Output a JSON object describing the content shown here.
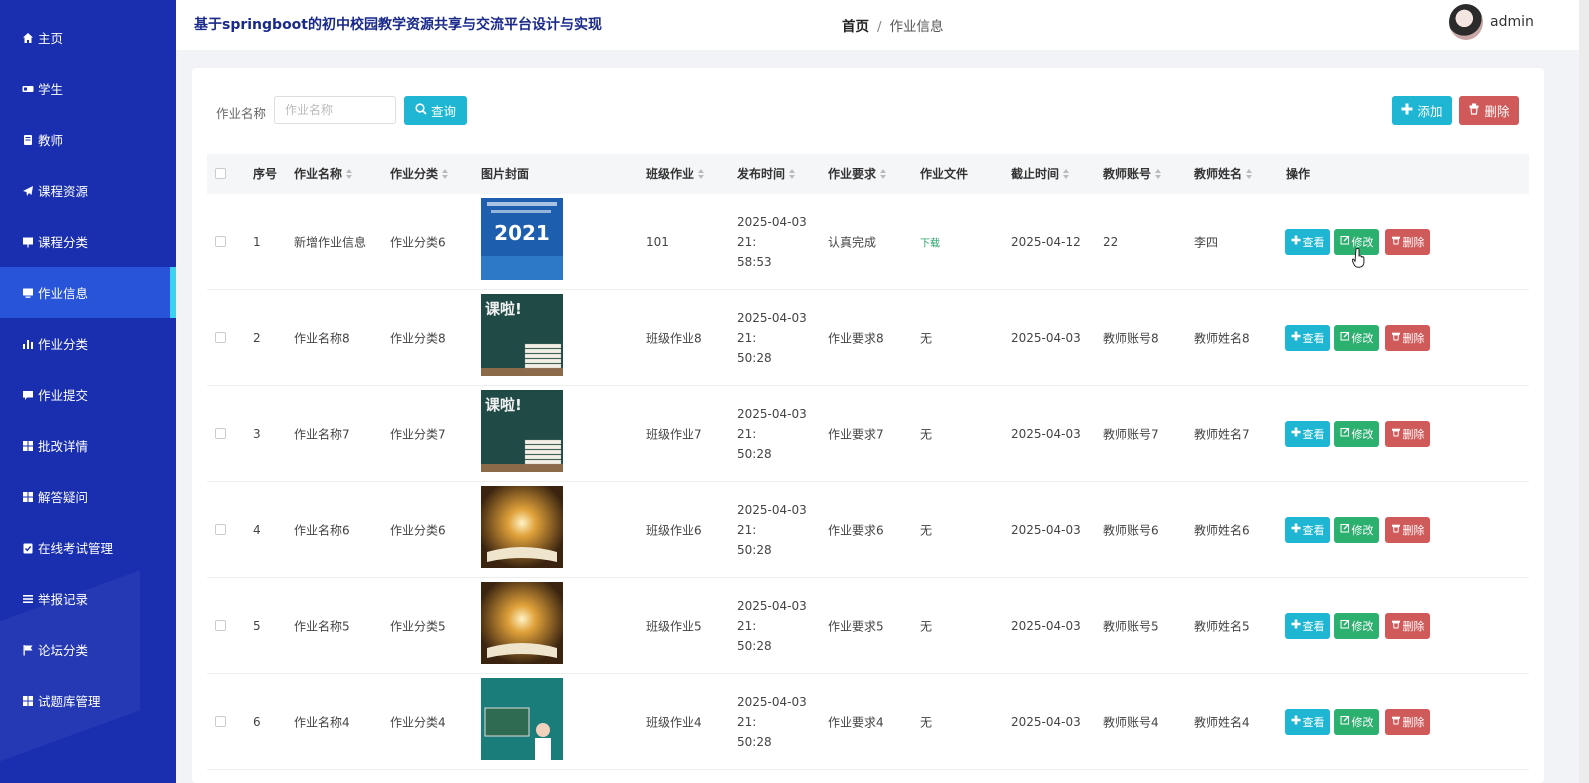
{
  "sidebar": {
    "items": [
      {
        "label": "主页",
        "icon": "home-icon"
      },
      {
        "label": "学生",
        "icon": "id-card-icon"
      },
      {
        "label": "教师",
        "icon": "teacher-icon"
      },
      {
        "label": "课程资源",
        "icon": "paper-plane-icon"
      },
      {
        "label": "课程分类",
        "icon": "board-icon"
      },
      {
        "label": "作业信息",
        "icon": "monitor-icon",
        "active": true
      },
      {
        "label": "作业分类",
        "icon": "bar-chart-icon"
      },
      {
        "label": "作业提交",
        "icon": "comment-icon"
      },
      {
        "label": "批改详情",
        "icon": "grid-icon"
      },
      {
        "label": "解答疑问",
        "icon": "grid-icon"
      },
      {
        "label": "在线考试管理",
        "icon": "clipboard-check-icon"
      },
      {
        "label": "举报记录",
        "icon": "list-icon"
      },
      {
        "label": "论坛分类",
        "icon": "flag-icon"
      },
      {
        "label": "试题库管理",
        "icon": "grid-icon"
      }
    ]
  },
  "header": {
    "app_title": "基于springboot的初中校园教学资源共享与交流平台设计与实现",
    "breadcrumb_home": "首页",
    "breadcrumb_sep": "/",
    "breadcrumb_current": "作业信息",
    "username": "admin"
  },
  "search": {
    "label": "作业名称",
    "placeholder": "作业名称",
    "query_label": "查询",
    "add_label": "添加",
    "delete_label": "删除"
  },
  "table": {
    "headers": [
      "序号",
      "作业名称",
      "作业分类",
      "图片封面",
      "班级作业",
      "发布时间",
      "作业要求",
      "作业文件",
      "截止时间",
      "教师账号",
      "教师姓名",
      "操作"
    ],
    "row_actions": {
      "view": "查看",
      "edit": "修改",
      "delete": "删除"
    },
    "rows": [
      {
        "no": "1",
        "name": "新增作业信息",
        "category": "作业分类6",
        "cover": "book-2021",
        "class_hw": "101",
        "pub_date": "2025-04-03 21:",
        "pub_time": "58:53",
        "requirement": "认真完成",
        "file": "下载",
        "deadline": "2025-04-12",
        "teacher_acct": "22",
        "teacher_name": "李四"
      },
      {
        "no": "2",
        "name": "作业名称8",
        "category": "作业分类8",
        "cover": "chalkboard",
        "class_hw": "班级作业8",
        "pub_date": "2025-04-03 21:",
        "pub_time": "50:28",
        "requirement": "作业要求8",
        "file": "无",
        "deadline": "2025-04-03",
        "teacher_acct": "教师账号8",
        "teacher_name": "教师姓名8"
      },
      {
        "no": "3",
        "name": "作业名称7",
        "category": "作业分类7",
        "cover": "chalkboard",
        "class_hw": "班级作业7",
        "pub_date": "2025-04-03 21:",
        "pub_time": "50:28",
        "requirement": "作业要求7",
        "file": "无",
        "deadline": "2025-04-03",
        "teacher_acct": "教师账号7",
        "teacher_name": "教师姓名7"
      },
      {
        "no": "4",
        "name": "作业名称6",
        "category": "作业分类6",
        "cover": "glow-book",
        "class_hw": "班级作业6",
        "pub_date": "2025-04-03 21:",
        "pub_time": "50:28",
        "requirement": "作业要求6",
        "file": "无",
        "deadline": "2025-04-03",
        "teacher_acct": "教师账号6",
        "teacher_name": "教师姓名6"
      },
      {
        "no": "5",
        "name": "作业名称5",
        "category": "作业分类5",
        "cover": "glow-book",
        "class_hw": "班级作业5",
        "pub_date": "2025-04-03 21:",
        "pub_time": "50:28",
        "requirement": "作业要求5",
        "file": "无",
        "deadline": "2025-04-03",
        "teacher_acct": "教师账号5",
        "teacher_name": "教师姓名5"
      },
      {
        "no": "6",
        "name": "作业名称4",
        "category": "作业分类4",
        "cover": "classroom",
        "class_hw": "班级作业4",
        "pub_date": "2025-04-03 21:",
        "pub_time": "50:28",
        "requirement": "作业要求4",
        "file": "无",
        "deadline": "2025-04-03",
        "teacher_acct": "教师账号4",
        "teacher_name": "教师姓名4"
      }
    ]
  },
  "cover_text": {
    "book-2021": "2021",
    "chalkboard": "课啦!"
  },
  "colors": {
    "sidebar": "#1a2fb0",
    "active": "#2854d9",
    "accent": "#1eb6d2",
    "edit": "#2cb06f",
    "danger": "#d05a5a"
  }
}
